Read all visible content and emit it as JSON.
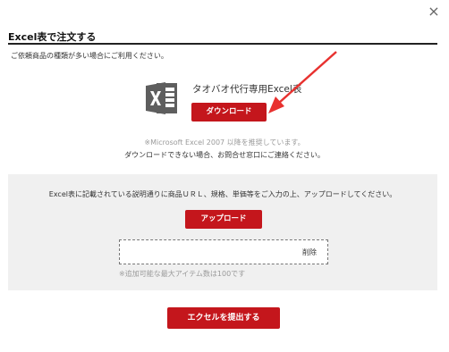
{
  "dialog": {
    "close_glyph": "×",
    "title": "Excel表で注文する",
    "subtitle": "ご依頼商品の種類が多い場合にご利用ください。"
  },
  "download": {
    "icon": "excel-file-icon",
    "file_name": "タオバオ代行専用Excel表",
    "button_label": "ダウンロード",
    "note_recommended": "※Microsoft Excel 2007 以降を推奨しています。",
    "note_contact": "ダウンロードできない場合、お問合せ窓口にご連絡ください。"
  },
  "upload": {
    "instruction": "Excel表に記載されている説明通りに商品ＵＲＬ、規格、単価等をご入力の上、アップロードしてください。",
    "button_label": "アップロード",
    "delete_label": "削除",
    "limit_note": "※追加可能な最大アイテム数は100です"
  },
  "submit": {
    "button_label": "エクセルを提出する"
  },
  "colors": {
    "accent_red": "#c4161c",
    "excel_icon_gray": "#5e5e5e",
    "panel_bg": "#f0f0f0",
    "arrow_red": "#e8312f"
  }
}
